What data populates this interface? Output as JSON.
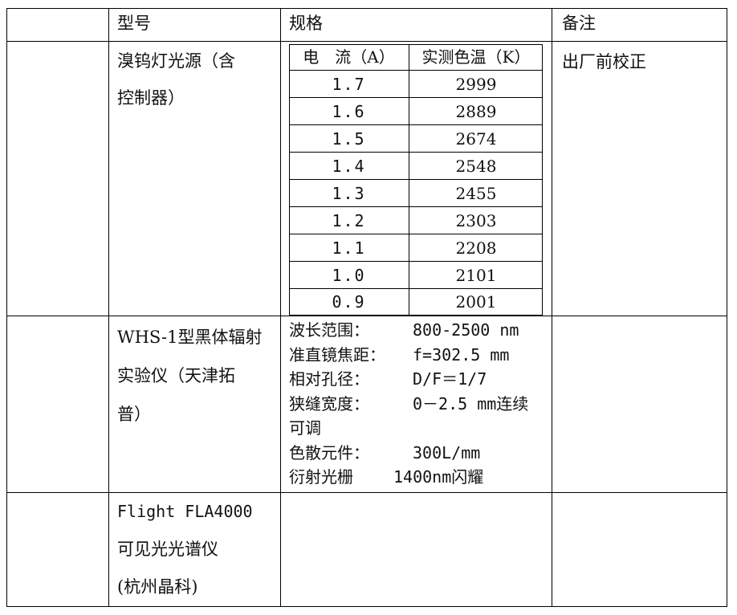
{
  "header": {
    "col_model": "型号",
    "col_spec": "规格",
    "col_remark": "备注"
  },
  "rows": [
    {
      "model_lines": [
        "溴钨灯光源（含",
        "控制器）"
      ],
      "remark": "出厂前校正",
      "spec_table": {
        "headers": [
          "电　流（A）",
          "实测色温（K）"
        ],
        "rows": [
          [
            "1.7",
            "2999"
          ],
          [
            "1.6",
            "2889"
          ],
          [
            "1.5",
            "2674"
          ],
          [
            "1.4",
            "2548"
          ],
          [
            "1.3",
            "2455"
          ],
          [
            "1.2",
            "2303"
          ],
          [
            "1.1",
            "2208"
          ],
          [
            "1.0",
            "2101"
          ],
          [
            "0.9",
            "2001"
          ]
        ]
      }
    },
    {
      "model_lines": [
        "WHS-1型黑体辐射",
        "实验仪（天津拓",
        "普）"
      ],
      "remark": "",
      "spec_lines": [
        {
          "key": "波长范围：",
          "value": "800-2500 nm"
        },
        {
          "key": "准直镜焦距：",
          "value": "f=302.5 mm"
        },
        {
          "key": "相对孔径：",
          "value": "D/F＝1/7"
        },
        {
          "key": "狭缝宽度：",
          "value": "0－2.5 mm连续"
        },
        {
          "key": "可调",
          "value": ""
        },
        {
          "key": "色散元件：",
          "value": "300L/mm"
        },
        {
          "key": "衍射光栅",
          "value": "1400nm闪耀"
        }
      ]
    },
    {
      "model_lines": [
        "Flight FLA4000",
        "可见光光谱仪",
        "(杭州晶科)"
      ],
      "remark": ""
    }
  ]
}
